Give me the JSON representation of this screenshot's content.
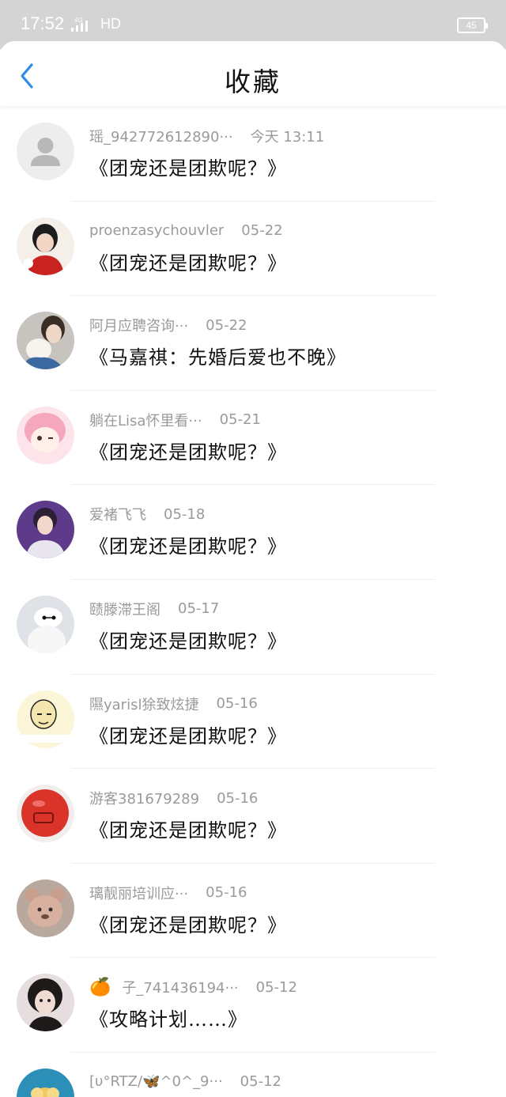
{
  "status_bar": {
    "time": "17:52",
    "network": "4G",
    "hd": "HD",
    "battery": "45"
  },
  "header": {
    "title": "收藏",
    "back_icon": "chevron-left-icon"
  },
  "colors": {
    "accent": "#2f8ce6",
    "meta_text": "#9a9a9a"
  },
  "items": [
    {
      "user": "瑶_942772612890···",
      "time": "今天 13:11",
      "title": "《团宠还是团欺呢？》",
      "avatar": "default"
    },
    {
      "user": "proenzasychouvler",
      "time": "05-22",
      "title": "《团宠还是团欺呢？》",
      "avatar": "boy-red"
    },
    {
      "user": "阿月应聘咨询···",
      "time": "05-22",
      "title": "《马嘉祺：先婚后爱也不晚》",
      "avatar": "girl-cat"
    },
    {
      "user": "躺在Lisa怀里看···",
      "time": "05-21",
      "title": "《团宠还是团欺呢？》",
      "avatar": "pink-cartoon"
    },
    {
      "user": "爱褚飞飞",
      "time": "05-18",
      "title": "《团宠还是团欺呢？》",
      "avatar": "singer"
    },
    {
      "user": "赜滕滞王阁",
      "time": "05-17",
      "title": "《团宠还是团欺呢？》",
      "avatar": "baymax"
    },
    {
      "user": "隰yarisl狳致炫捷",
      "time": "05-16",
      "title": "《团宠还是团欺呢？》",
      "avatar": "meme"
    },
    {
      "user": "游客381679289",
      "time": "05-16",
      "title": "《团宠还是团欺呢？》",
      "avatar": "red-ball"
    },
    {
      "user": "璃靓丽培训应···",
      "time": "05-16",
      "title": "《团宠还是团欺呢？》",
      "avatar": "bear"
    },
    {
      "user": "子_741436194···",
      "time": "05-12",
      "title": "《攻略计划……》",
      "avatar": "girl-dark",
      "emoji": "🍊"
    },
    {
      "user": "[υ°RTZ/🦋^0^_9···",
      "time": "05-12",
      "title": "",
      "avatar": "flower"
    }
  ]
}
